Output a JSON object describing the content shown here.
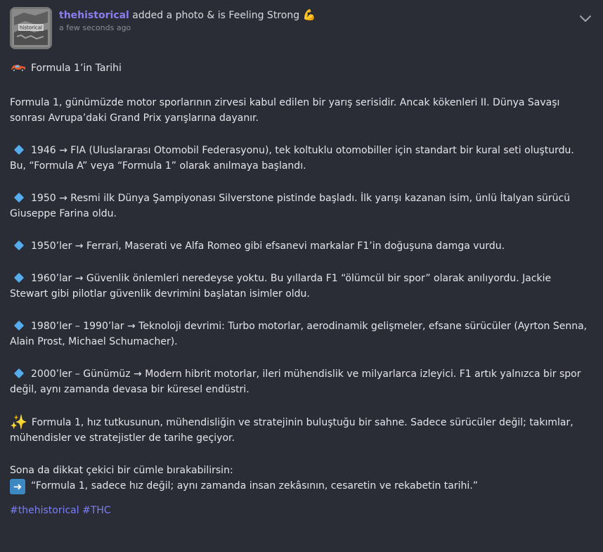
{
  "header": {
    "author": "thehistorical",
    "action": "added a photo & is Feeling Strong",
    "feeling_emoji": "💪",
    "timestamp": "a few seconds ago",
    "avatar_text": "historical",
    "menu_icon": "chevron-down-icon"
  },
  "post": {
    "title_icon": "race-car-icon",
    "title": "Formula 1’in Tarihi",
    "intro": "Formula 1, günümüzde motor sporlarının zirvesi kabul edilen bir yarış serisidir. Ancak kökenleri II. Dünya Savaşı sonrası Avrupa’daki Grand Prix yarışlarına dayanır.",
    "timeline": [
      {
        "icon": "blue-diamond-icon",
        "text": "1946 → FIA (Uluslararası Otomobil Federasyonu), tek koltuklu otomobiller için standart bir kural seti oluşturdu. Bu, “Formula A” veya “Formula 1” olarak anılmaya başlandı."
      },
      {
        "icon": "blue-diamond-icon",
        "text": "1950 → Resmi ilk Dünya Şampiyonası Silverstone pistinde başladı. İlk yarışı kazanan isim, ünlü İtalyan sürücü Giuseppe Farina oldu."
      },
      {
        "icon": "blue-diamond-icon",
        "text": "1950’ler → Ferrari, Maserati ve Alfa Romeo gibi efsanevi markalar F1’in doğuşuna damga vurdu."
      },
      {
        "icon": "blue-diamond-icon",
        "text": "1960’lar → Güvenlik önlemleri neredeyse yoktu. Bu yıllarda F1 “ölümcül bir spor” olarak anılıyordu. Jackie Stewart gibi pilotlar güvenlik devrimini başlatan isimler oldu."
      },
      {
        "icon": "blue-diamond-icon",
        "text": "1980’ler – 1990’lar → Teknoloji devrimi: Turbo motorlar, aerodinamik gelişmeler, efsane sürücüler (Ayrton Senna, Alain Prost, Michael Schumacher)."
      },
      {
        "icon": "blue-diamond-icon",
        "text": "2000’ler – Günümüz → Modern hibrit motorlar, ileri mühendislik ve milyarlarca izleyici. F1 artık yalnızca bir spor değil, aynı zamanda devasa bir küresel endüstri."
      }
    ],
    "conclusion_icon": "sparkles-icon",
    "conclusion": "Formula 1, hız tutkusunun, mühendisliğin ve stratejinin buluştuğu bir sahne. Sadece sürücüler değil; takımlar, mühendisler ve stratejistler de tarihe geçiyor.",
    "closing_prompt": "Sona da dikkat çekici bir cümle bırakabilirsin:",
    "closing_icon": "right-arrow-icon",
    "closing_quote": "“Formula 1, sadece hız değil; aynı zamanda insan zekâsının, cesaretin ve rekabetin tarihi.”",
    "hashtags": [
      "#thehistorical",
      "#THC"
    ]
  },
  "colors": {
    "background": "#2b2d36",
    "author": "#8b7cf0",
    "hashtag": "#7b7ff5",
    "diamond": "#55acee"
  }
}
